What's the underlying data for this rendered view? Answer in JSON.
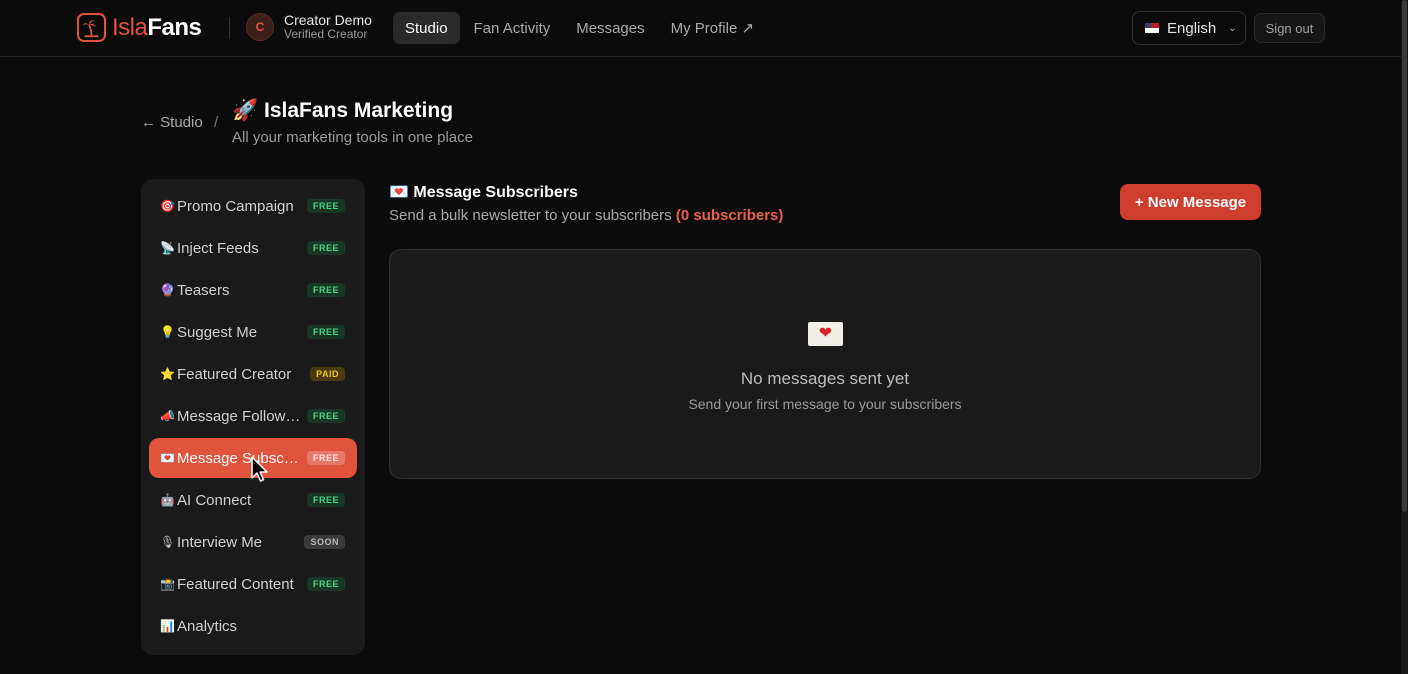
{
  "header": {
    "logo_part1": "Isla",
    "logo_part2": "Fans",
    "user": {
      "initial": "C",
      "name": "Creator Demo",
      "status": "Verified Creator"
    },
    "nav": [
      {
        "label": "Studio",
        "active": true
      },
      {
        "label": "Fan Activity",
        "active": false
      },
      {
        "label": "Messages",
        "active": false
      },
      {
        "label": "My Profile ↗",
        "active": false
      }
    ],
    "language": "English",
    "sign_out": "Sign out"
  },
  "page": {
    "back_link": "← Studio",
    "separator": "/",
    "title": "🚀 IslaFans Marketing",
    "subtitle": "All your marketing tools in one place"
  },
  "sidebar": {
    "items": [
      {
        "icon": "🎯",
        "label": "Promo Campaign",
        "badge": "FREE",
        "badge_type": "free"
      },
      {
        "icon": "📡",
        "label": "Inject Feeds",
        "badge": "FREE",
        "badge_type": "free"
      },
      {
        "icon": "🔮",
        "label": "Teasers",
        "badge": "FREE",
        "badge_type": "free"
      },
      {
        "icon": "💡",
        "label": "Suggest Me",
        "badge": "FREE",
        "badge_type": "free"
      },
      {
        "icon": "⭐",
        "label": "Featured Creator",
        "badge": "PAID",
        "badge_type": "paid"
      },
      {
        "icon": "📣",
        "label": "Message Followers",
        "badge": "FREE",
        "badge_type": "free"
      },
      {
        "icon": "💌",
        "label": "Message Subscribers",
        "badge": "FREE",
        "badge_type": "free",
        "active": true
      },
      {
        "icon": "🤖",
        "label": "AI Connect",
        "badge": "FREE",
        "badge_type": "free"
      },
      {
        "icon": "🎙",
        "label": "Interview Me",
        "badge": "SOON",
        "badge_type": "soon"
      },
      {
        "icon": "📸",
        "label": "Featured Content",
        "badge": "FREE",
        "badge_type": "free"
      },
      {
        "icon": "📊",
        "label": "Analytics",
        "badge": "",
        "badge_type": ""
      }
    ]
  },
  "main": {
    "section_icon": "💌",
    "section_title": "Message Subscribers",
    "section_sub": "Send a bulk newsletter to your subscribers",
    "subscriber_count": "(0 subscribers)",
    "new_button": "+ New Message",
    "empty_icon": "❤",
    "empty_title": "No messages sent yet",
    "empty_sub": "Send your first message to your subscribers"
  },
  "colors": {
    "accent": "#e0533d",
    "button": "#cf3d2c",
    "free_badge": "#4ed082",
    "paid_badge": "#f2c230"
  }
}
